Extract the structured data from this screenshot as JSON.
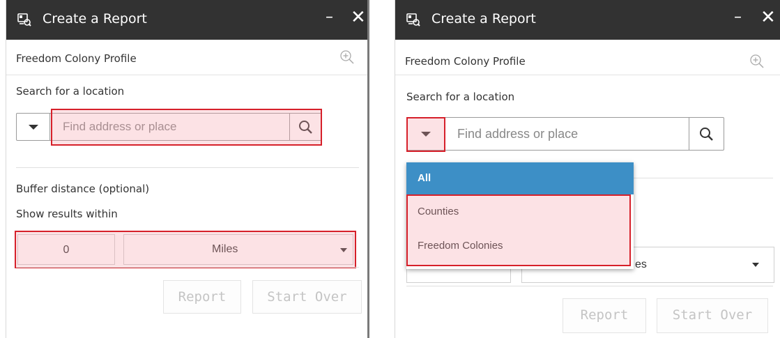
{
  "panel1": {
    "title": "Create a Report",
    "minimize": "–",
    "close": "✕",
    "profile": "Freedom Colony Profile",
    "search_label": "Search for a location",
    "search_placeholder": "Find address or place",
    "buffer_label": "Buffer distance (optional)",
    "within_label": "Show results within",
    "distance_value": "0",
    "unit": "Miles",
    "report_button": "Report",
    "start_over_button": "Start Over"
  },
  "panel2": {
    "title": "Create a Report",
    "minimize": "–",
    "close": "✕",
    "profile": "Freedom Colony Profile",
    "search_label": "Search for a location",
    "search_placeholder": "Find address or place",
    "dropdown_options": [
      "All",
      "Counties",
      "Freedom Colonies"
    ],
    "selected_option": "All",
    "unit_partial": "es",
    "report_button": "Report",
    "start_over_button": "Start Over"
  },
  "colors": {
    "titlebar": "#323232",
    "highlight_border": "#d6202a",
    "selected_option": "#3d8fc6",
    "disabled_text": "#c4c4c4"
  },
  "icons": [
    "report-app-icon",
    "zoom-in-icon",
    "search-icon",
    "dropdown-caret-icon",
    "minimize-icon",
    "close-icon"
  ]
}
